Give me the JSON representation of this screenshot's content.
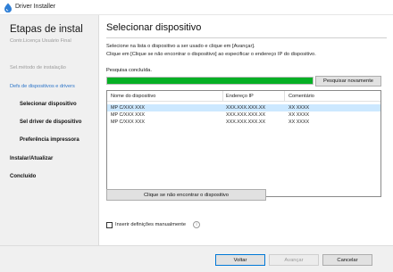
{
  "window": {
    "title": "Driver Installer"
  },
  "sidebar": {
    "heading": "Etapas de instal",
    "steps": [
      {
        "label": "Contr.Licença Usuário Final",
        "state": "done"
      },
      {
        "label": "Sel.método de instalação",
        "state": "done"
      },
      {
        "label": "Defs de dispositivos e drivers",
        "state": "active-group"
      },
      {
        "label": "Selecionar dispositivo",
        "state": "current"
      },
      {
        "label": "Sel driver de dispositivo",
        "state": "pending"
      },
      {
        "label": "Preferência impressora",
        "state": "pending"
      },
      {
        "label": "Instalar/Atualizar",
        "state": "pending"
      },
      {
        "label": "Concluído",
        "state": "pending"
      }
    ]
  },
  "main": {
    "title": "Selecionar dispositivo",
    "instruction_line1": "Selecione na lista o dispositivo a ser usado e clique em [Avançar].",
    "instruction_line2": "Clique em [Clique se não encontrar o dispositivo] ao especificar o endereço IP do dispositivo.",
    "status": "Pesquisa concluída.",
    "progress": 1.0,
    "search_again_label": "Pesquisar novamente",
    "table": {
      "columns": [
        "Nome do dispositivo",
        "Endereço IP",
        "Comentário"
      ],
      "rows": [
        [
          "MP C/XXX XXX",
          "XXX.XXX.XXX.XX",
          "XX XXXX"
        ],
        [
          "MP C/XXX XXX",
          "XXX.XXX.XXX.XX",
          "XX XXXX"
        ],
        [
          "MP C/XXX XXX",
          "XXX.XXX.XXX.XX",
          "XX XXXX"
        ]
      ],
      "selected_row": 0
    },
    "not_found_label": "Clique se não encontrar o dispositivo",
    "manual_settings_label": "Inserir definições manualmente",
    "manual_settings_checked": false
  },
  "footer": {
    "back_label": "Voltar",
    "next_label": "Avançar",
    "cancel_label": "Cancelar"
  },
  "colors": {
    "accent": "#0078d7",
    "progress": "#06b025",
    "link": "#2a73c8",
    "selection": "#cce8ff"
  }
}
